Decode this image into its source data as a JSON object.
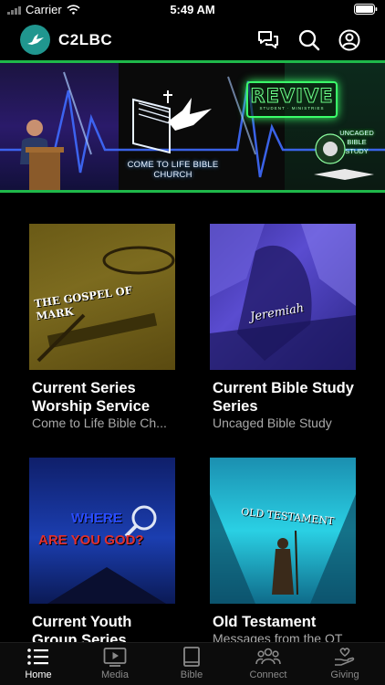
{
  "status_bar": {
    "carrier": "Carrier",
    "time": "5:49 AM"
  },
  "header": {
    "title": "C2LBC",
    "icons": [
      "chat-icon",
      "search-icon",
      "account-icon"
    ]
  },
  "banner": {
    "church_name": "COME TO LIFE BIBLE CHURCH",
    "revive_title": "REVIVE",
    "revive_subtitle": "STUDENT · MINISTRIES",
    "uncaged_text": "UNCAGED BIBLE STUDY"
  },
  "cards": [
    {
      "art_text": "THE GOSPEL OF MARK",
      "title": "Current Series Worship Service",
      "subtitle": "Come to Life Bible Ch..."
    },
    {
      "art_text": "Jeremiah",
      "title": "Current Bible Study Series",
      "subtitle": "Uncaged Bible Study"
    },
    {
      "art_text_1": "WHERE",
      "art_text_2": "ARE YOU GOD?",
      "title": "Current Youth Group Series",
      "subtitle": ""
    },
    {
      "art_text": "OLD TESTAMENT",
      "title": "Old Testament",
      "subtitle": "Messages from the OT"
    }
  ],
  "tabs": [
    {
      "label": "Home",
      "icon": "list-icon",
      "active": true
    },
    {
      "label": "Media",
      "icon": "play-icon",
      "active": false
    },
    {
      "label": "Bible",
      "icon": "book-icon",
      "active": false
    },
    {
      "label": "Connect",
      "icon": "people-icon",
      "active": false
    },
    {
      "label": "Giving",
      "icon": "giving-icon",
      "active": false
    }
  ],
  "colors": {
    "accent_green": "#1fb84a",
    "logo_teal": "#20968f",
    "muted_text": "#a9a9a9"
  }
}
